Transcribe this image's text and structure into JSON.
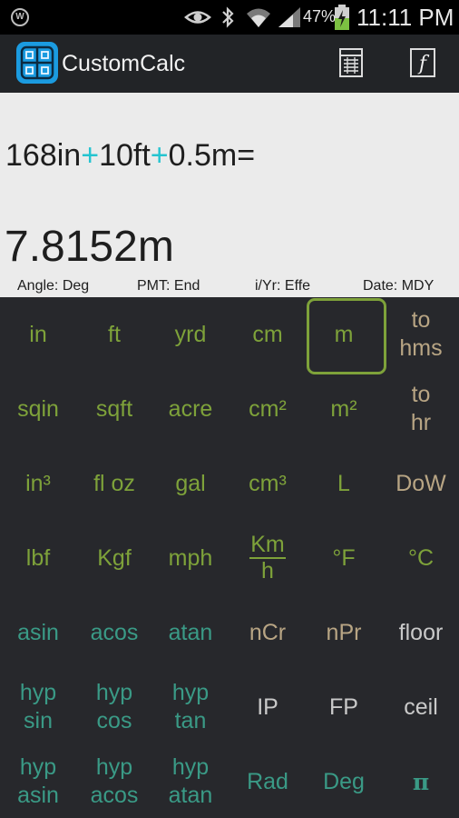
{
  "status_bar": {
    "battery_percent": "47%",
    "time": "11:11 PM",
    "icons": [
      "w-notification-icon",
      "eye-icon",
      "bluetooth-icon",
      "wifi-icon",
      "signal-icon",
      "battery-charging-icon"
    ],
    "notification_letter": "W"
  },
  "app_bar": {
    "title": "CustomCalc",
    "logo_icon": "calculator-grid-icon",
    "actions": [
      "table-icon",
      "function-icon"
    ]
  },
  "display": {
    "expression": {
      "a": "168in",
      "op1": "+",
      "b": "10ft",
      "op2": "+",
      "c": "0.5m="
    },
    "result": "7.8152m",
    "modes": {
      "angle": "Angle: Deg",
      "pmt": "PMT: End",
      "iyr": "i/Yr: Effe",
      "date": "Date: MDY"
    }
  },
  "keys": {
    "in": "in",
    "ft": "ft",
    "yrd": "yrd",
    "cm": "cm",
    "m": "m",
    "to_hms_1": "to",
    "to_hms_2": "hms",
    "sqin": "sqin",
    "sqft": "sqft",
    "acre": "acre",
    "cm2": "cm²",
    "m2": "m²",
    "to_hr_1": "to",
    "to_hr_2": "hr",
    "in3": "in³",
    "floz": "fl oz",
    "gal": "gal",
    "cm3": "cm³",
    "L": "L",
    "dow": "DoW",
    "lbf": "lbf",
    "kgf": "Kgf",
    "mph": "mph",
    "kmh_num": "Km",
    "kmh_den": "h",
    "degF": "°F",
    "degC": "°C",
    "asin": "asin",
    "acos": "acos",
    "atan": "atan",
    "ncr": "nCr",
    "npr": "nPr",
    "floor": "floor",
    "hyp": "hyp",
    "sin": "sin",
    "cos": "cos",
    "tan": "tan",
    "ip": "IP",
    "fp": "FP",
    "ceil": "ceil",
    "asin2": "asin",
    "acos2": "acos",
    "atan2": "atan",
    "rad": "Rad",
    "deg": "Deg",
    "pi": "π"
  },
  "selected_key": "m",
  "colors": {
    "unit_key": "#7ea23a",
    "trig_key": "#3a9a86",
    "combinatoric_key": "#b8a584",
    "func_key": "#c9c9c9",
    "operator_accent": "#25c4d0",
    "logo": "#1b9be0"
  }
}
